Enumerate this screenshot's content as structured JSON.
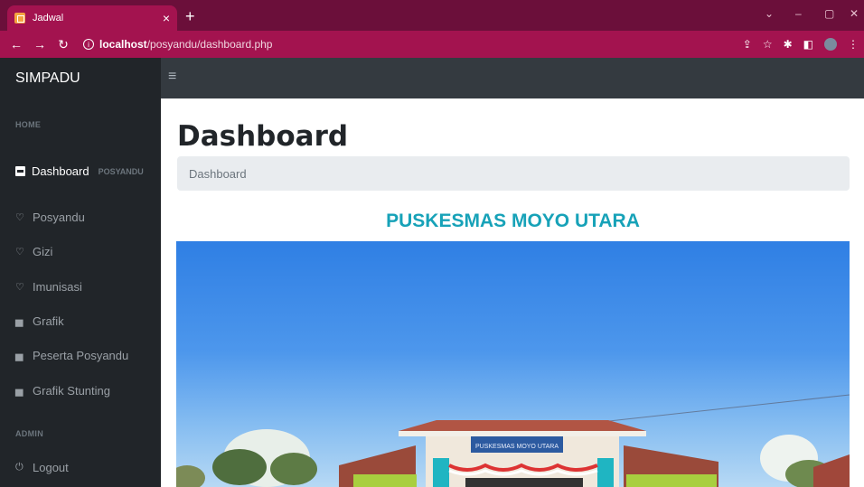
{
  "browser": {
    "tab_title": "Jadwal",
    "tab_close": "×",
    "new_tab": "+",
    "url_host": "localhost",
    "url_path": "/posyandu/dashboard.php",
    "window_controls": [
      "⌄",
      "–",
      "▢",
      "✕"
    ]
  },
  "app": {
    "brand": "SIMPADU",
    "toggler": "≡"
  },
  "sidebar": {
    "headings": [
      "HOME",
      "ADMIN"
    ],
    "dashboard_label": "Dashboard",
    "dashboard_sub": "POSYANDU",
    "items": [
      {
        "label": "Posyandu",
        "icon": "stethoscope-icon"
      },
      {
        "label": "Gizi",
        "icon": "stethoscope-icon"
      },
      {
        "label": "Imunisasi",
        "icon": "stethoscope-icon"
      },
      {
        "label": "Grafik",
        "icon": "chart-icon"
      },
      {
        "label": "Peserta Posyandu",
        "icon": "chart-icon"
      },
      {
        "label": "Grafik Stunting",
        "icon": "chart-icon"
      }
    ],
    "logout_label": "Logout"
  },
  "main": {
    "title": "Dashboard",
    "breadcrumb": "Dashboard",
    "headline": "PUSKESMAS MOYO UTARA",
    "building_sign": "PUSKESMAS MOYO UTARA"
  },
  "colors": {
    "accent": "#17a2b8",
    "sidebar_bg": "#212529",
    "header_bg": "#343a40",
    "browser_tab": "#a3134f"
  }
}
